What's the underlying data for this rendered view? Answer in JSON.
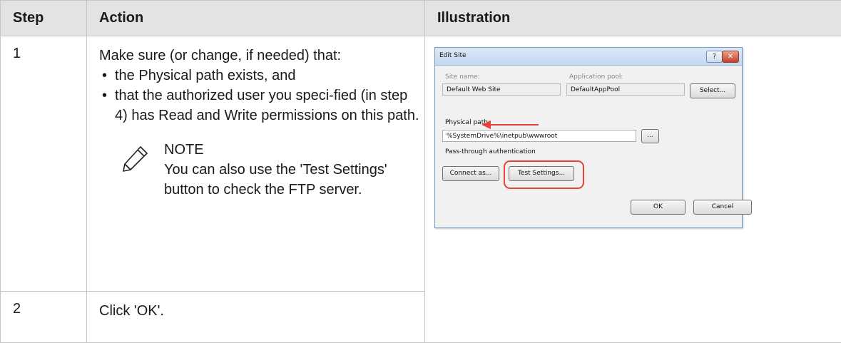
{
  "table": {
    "headers": [
      "Step",
      "Action",
      "Illustration"
    ],
    "rows": [
      {
        "step": "1",
        "intro": "Make sure (or change, if needed) that:",
        "bullets": [
          "the Physical path exists, and",
          "that the authorized user you speci-fied (in step 4) has Read and Write permissions on this path."
        ],
        "note_heading": "NOTE",
        "note_text": "You can also use the 'Test Settings' button to check the FTP server."
      },
      {
        "step": "2",
        "action": "Click 'OK'."
      }
    ],
    "bullet_glyph": "•"
  },
  "dialog": {
    "title": "Edit Site",
    "help_glyph": "?",
    "close_glyph": "✕",
    "site_name_label": "Site name:",
    "site_name_value": "Default Web Site",
    "app_pool_label": "Application pool:",
    "app_pool_value": "DefaultAppPool",
    "select_button": "Select...",
    "physical_path_label": "Physical path:",
    "physical_path_value": "%SystemDrive%\\inetpub\\wwwroot",
    "browse_button": "...",
    "pass_through_label": "Pass-through authentication",
    "connect_as_button": "Connect as...",
    "test_settings_button": "Test Settings...",
    "ok_button": "OK",
    "cancel_button": "Cancel",
    "highlight_color": "#e8423a"
  }
}
